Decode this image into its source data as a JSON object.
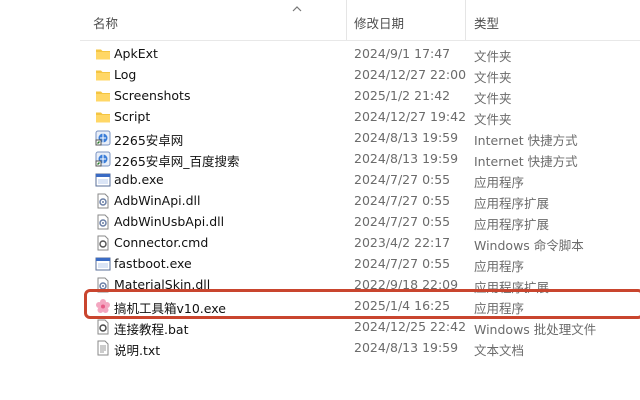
{
  "columns": {
    "name": "名称",
    "date": "修改日期",
    "type": "类型"
  },
  "files": [
    {
      "icon": "folder-icon",
      "name": "ApkExt",
      "date": "2024/9/1 17:47",
      "type": "文件夹"
    },
    {
      "icon": "folder-icon",
      "name": "Log",
      "date": "2024/12/27 22:00",
      "type": "文件夹"
    },
    {
      "icon": "folder-icon",
      "name": "Screenshots",
      "date": "2025/1/2 21:42",
      "type": "文件夹"
    },
    {
      "icon": "folder-icon",
      "name": "Script",
      "date": "2024/12/27 19:42",
      "type": "文件夹"
    },
    {
      "icon": "internet-shortcut-icon",
      "name": "2265安卓网",
      "date": "2024/8/13 19:59",
      "type": "Internet 快捷方式"
    },
    {
      "icon": "internet-shortcut-icon",
      "name": "2265安卓网_百度搜索",
      "date": "2024/8/13 19:59",
      "type": "Internet 快捷方式"
    },
    {
      "icon": "application-icon",
      "name": "adb.exe",
      "date": "2024/7/27 0:55",
      "type": "应用程序"
    },
    {
      "icon": "dll-icon",
      "name": "AdbWinApi.dll",
      "date": "2024/7/27 0:55",
      "type": "应用程序扩展"
    },
    {
      "icon": "dll-icon",
      "name": "AdbWinUsbApi.dll",
      "date": "2024/7/27 0:55",
      "type": "应用程序扩展"
    },
    {
      "icon": "command-script-icon",
      "name": "Connector.cmd",
      "date": "2023/4/2 22:17",
      "type": "Windows 命令脚本"
    },
    {
      "icon": "application-icon",
      "name": "fastboot.exe",
      "date": "2024/7/27 0:55",
      "type": "应用程序"
    },
    {
      "icon": "dll-icon",
      "name": "MaterialSkin.dll",
      "date": "2022/9/18 22:09",
      "type": "应用程序扩展"
    },
    {
      "icon": "flower-app-icon",
      "name": "搞机工具箱v10.exe",
      "date": "2025/1/4 16:25",
      "type": "应用程序"
    },
    {
      "icon": "batch-file-icon",
      "name": "连接教程.bat",
      "date": "2024/12/25 22:42",
      "type": "Windows 批处理文件"
    },
    {
      "icon": "text-file-icon",
      "name": "说明.txt",
      "date": "2024/8/13 19:59",
      "type": "文本文档"
    }
  ],
  "highlight_color": "#c9452e"
}
